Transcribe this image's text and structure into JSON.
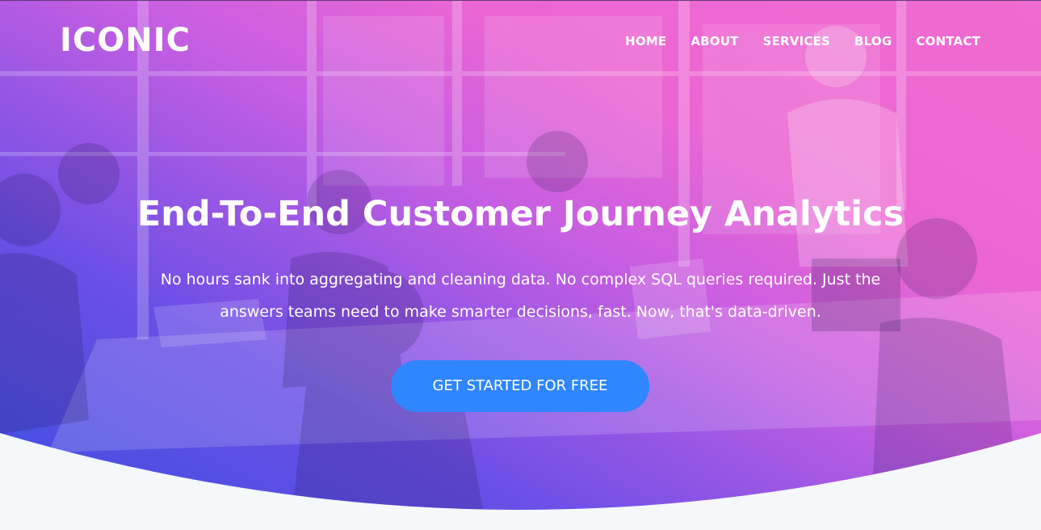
{
  "brand": {
    "logo_text": "ICONIC"
  },
  "nav": {
    "items": [
      {
        "label": "HOME"
      },
      {
        "label": "ABOUT"
      },
      {
        "label": "SERVICES"
      },
      {
        "label": "BLOG"
      },
      {
        "label": "CONTACT"
      }
    ]
  },
  "hero": {
    "title": "End-To-End Customer Journey Analytics",
    "subtitle": "No hours sank into aggregating and cleaning data. No complex SQL queries required. Just the answers teams need to make smarter decisions, fast. Now, that's data-driven.",
    "cta_label": "GET STARTED FOR FREE",
    "overlay_colors": [
      "#3b4fe0",
      "#6a4fe6",
      "#c75ee2",
      "#ec66d3"
    ],
    "accent_color": "#2f86ff",
    "background_image": "meeting-room-photo"
  },
  "section_below": {
    "background_color": "#f4f8fb"
  }
}
